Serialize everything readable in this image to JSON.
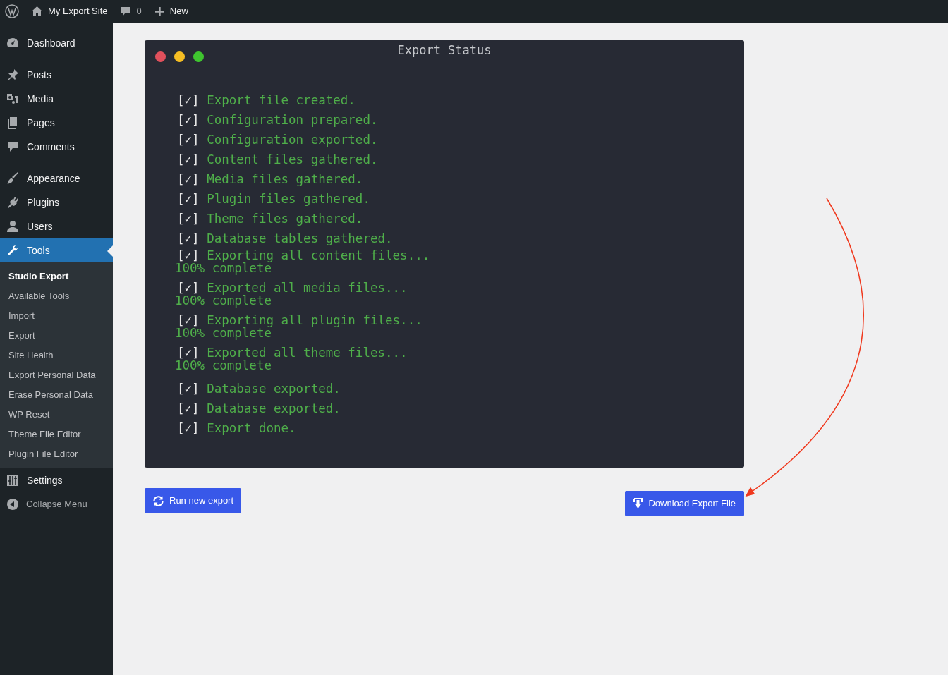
{
  "admin_bar": {
    "site_name": "My Export Site",
    "comments_count": "0",
    "new_label": "New"
  },
  "sidebar": {
    "groups": [
      [
        {
          "label": "Dashboard",
          "kind": "dashboard",
          "selected": false
        }
      ],
      [
        {
          "label": "Posts",
          "kind": "pin",
          "selected": false
        },
        {
          "label": "Media",
          "kind": "media",
          "selected": false
        },
        {
          "label": "Pages",
          "kind": "pages",
          "selected": false
        },
        {
          "label": "Comments",
          "kind": "comment",
          "selected": false
        }
      ],
      [
        {
          "label": "Appearance",
          "kind": "brush",
          "selected": false
        },
        {
          "label": "Plugins",
          "kind": "plug",
          "selected": false
        },
        {
          "label": "Users",
          "kind": "user",
          "selected": false
        },
        {
          "label": "Tools",
          "kind": "wrench",
          "selected": true,
          "submenu": [
            {
              "label": "Studio Export",
              "selected": true
            },
            {
              "label": "Available Tools",
              "selected": false
            },
            {
              "label": "Import",
              "selected": false
            },
            {
              "label": "Export",
              "selected": false
            },
            {
              "label": "Site Health",
              "selected": false
            },
            {
              "label": "Export Personal Data",
              "selected": false
            },
            {
              "label": "Erase Personal Data",
              "selected": false
            },
            {
              "label": "WP Reset",
              "selected": false
            },
            {
              "label": "Theme File Editor",
              "selected": false
            },
            {
              "label": "Plugin File Editor",
              "selected": false
            }
          ]
        },
        {
          "label": "Settings",
          "kind": "sliders",
          "selected": false
        }
      ]
    ],
    "collapse_label": "Collapse Menu"
  },
  "terminal": {
    "title": "Export Status",
    "lines": [
      {
        "mark": "[✓]",
        "text": "Export file created."
      },
      {
        "mark": "[✓]",
        "text": "Configuration prepared."
      },
      {
        "mark": "[✓]",
        "text": "Configuration exported."
      },
      {
        "mark": "[✓]",
        "text": "Content files gathered."
      },
      {
        "mark": "[✓]",
        "text": "Media files gathered."
      },
      {
        "mark": "[✓]",
        "text": "Plugin files gathered."
      },
      {
        "mark": "[✓]",
        "text": "Theme files gathered."
      },
      {
        "mark": "[✓]",
        "text": "Database tables gathered."
      },
      {
        "mark": "[✓]",
        "text": "Exporting all content files...",
        "progress": "100% complete"
      },
      {
        "mark": "[✓]",
        "text": "Exported all media files...",
        "progress": "100% complete"
      },
      {
        "mark": "[✓]",
        "text": "Exporting all plugin files...",
        "progress": "100% complete"
      },
      {
        "mark": "[✓]",
        "text": "Exported all theme files...",
        "progress": "100% complete"
      },
      {
        "mark": "[✓]",
        "text": "Database exported."
      },
      {
        "mark": "[✓]",
        "text": "Database exported."
      },
      {
        "mark": "[✓]",
        "text": "Export done."
      }
    ]
  },
  "buttons": {
    "run_new_export": "Run new export",
    "download": "Download Export File"
  }
}
